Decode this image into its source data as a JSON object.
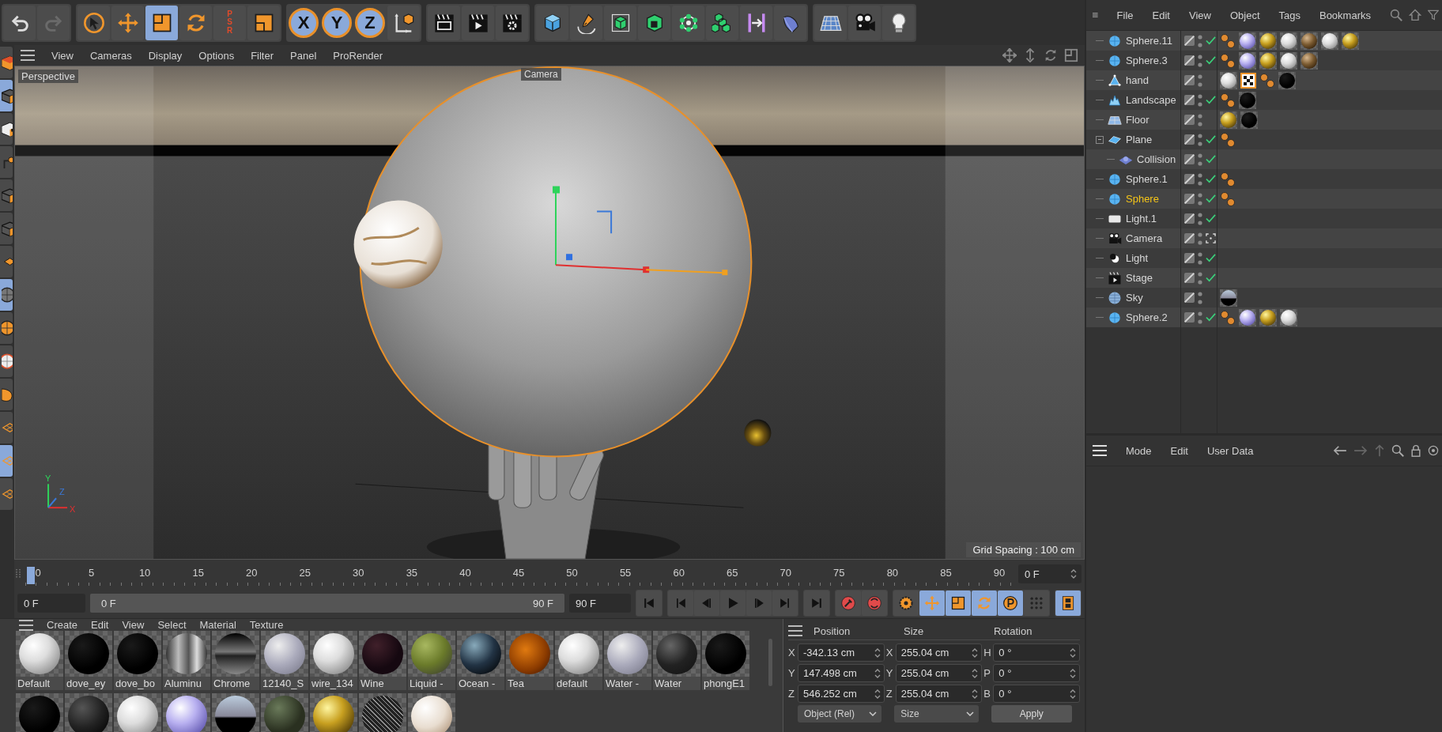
{
  "toolbar": [
    [
      {
        "kind": "undo",
        "selected": false
      },
      {
        "kind": "redo",
        "selected": false
      }
    ],
    [
      {
        "kind": "select",
        "selected": false
      },
      {
        "kind": "move",
        "selected": false
      },
      {
        "kind": "scale",
        "selected": true
      },
      {
        "kind": "rotate",
        "selected": false
      },
      {
        "kind": "psr",
        "label": "PSR",
        "selected": false
      },
      {
        "kind": "model",
        "selected": false
      }
    ],
    [
      {
        "kind": "axis",
        "label": "X",
        "selected": true
      },
      {
        "kind": "axis",
        "label": "Y",
        "selected": true
      },
      {
        "kind": "axis",
        "label": "Z",
        "selected": true
      },
      {
        "kind": "coord",
        "selected": false
      }
    ],
    [
      {
        "kind": "render-view",
        "selected": false
      },
      {
        "kind": "render",
        "selected": false
      },
      {
        "kind": "render-settings",
        "selected": false
      }
    ],
    [
      {
        "kind": "cube",
        "selected": false
      },
      {
        "kind": "pen",
        "selected": false
      },
      {
        "kind": "subdivide",
        "selected": false
      },
      {
        "kind": "extrude",
        "selected": false
      },
      {
        "kind": "cloner",
        "selected": false
      },
      {
        "kind": "array",
        "selected": false
      },
      {
        "kind": "symmetry",
        "selected": false
      },
      {
        "kind": "deformer",
        "selected": false
      }
    ],
    [
      {
        "kind": "floor",
        "selected": false
      },
      {
        "kind": "camera",
        "selected": false
      },
      {
        "kind": "light",
        "selected": false
      }
    ]
  ],
  "left_tools": [
    {
      "kind": "model",
      "selected": false
    },
    {
      "kind": "cube",
      "selected": true
    },
    {
      "kind": "checker",
      "selected": false
    },
    {
      "kind": "vertex",
      "selected": false
    },
    {
      "kind": "cube",
      "selected": false
    },
    {
      "kind": "cube",
      "selected": false
    },
    {
      "kind": "diamond",
      "selected": false
    },
    {
      "kind": "sphere",
      "selected": true
    },
    {
      "kind": "orange-sphere",
      "selected": false
    },
    {
      "kind": "white-sphere",
      "selected": false
    },
    {
      "kind": "blob",
      "selected": false
    },
    {
      "kind": "workplane",
      "selected": false
    },
    {
      "kind": "workplane",
      "selected": true
    },
    {
      "kind": "workplane",
      "selected": false
    }
  ],
  "viewport": {
    "menus": [
      "View",
      "Cameras",
      "Display",
      "Options",
      "Filter",
      "Panel",
      "ProRender"
    ],
    "name": "Perspective",
    "camera_label": "Camera",
    "grid_spacing": "Grid Spacing : 100 cm",
    "axes": [
      "Y",
      "Z",
      "X"
    ]
  },
  "timeline": {
    "ticks": [
      "0",
      "5",
      "10",
      "15",
      "20",
      "25",
      "30",
      "35",
      "40",
      "45",
      "50",
      "55",
      "60",
      "65",
      "70",
      "75",
      "80",
      "85",
      "90"
    ],
    "current_frame": "0 F",
    "start_field": "0 F",
    "range": {
      "start": "0 F",
      "end": "90 F",
      "level": 1
    },
    "end_field": "90 F",
    "controls": [
      [
        {
          "kind": "first",
          "selected": false
        }
      ],
      [
        {
          "kind": "prev-key",
          "selected": false
        },
        {
          "kind": "prev",
          "selected": false
        },
        {
          "kind": "play",
          "selected": false
        },
        {
          "kind": "next",
          "selected": false
        },
        {
          "kind": "next-key",
          "selected": false
        }
      ],
      [
        {
          "kind": "last",
          "selected": false
        }
      ],
      [
        {
          "kind": "record",
          "selected": false
        },
        {
          "kind": "autokey",
          "selected": false
        }
      ],
      [
        {
          "kind": "key-settings",
          "selected": false
        },
        {
          "kind": "move",
          "selected": true
        },
        {
          "kind": "scale",
          "selected": true
        },
        {
          "kind": "rotate",
          "selected": true
        },
        {
          "kind": "param",
          "selected": true
        },
        {
          "kind": "pla",
          "selected": false
        }
      ],
      [
        {
          "kind": "film",
          "selected": true
        }
      ]
    ]
  },
  "materials": {
    "menus": [
      "Create",
      "Edit",
      "View",
      "Select",
      "Material",
      "Texture"
    ],
    "items": [
      {
        "name": "Default",
        "kind": "white"
      },
      {
        "name": "dove_ey",
        "kind": "black"
      },
      {
        "name": "dove_bo",
        "kind": "black"
      },
      {
        "name": "Aluminu",
        "kind": "aluminium"
      },
      {
        "name": "Chrome",
        "kind": "chrome"
      },
      {
        "name": "12140_S",
        "kind": "glass"
      },
      {
        "name": "wire_134",
        "kind": "white"
      },
      {
        "name": "Wine",
        "kind": "wine"
      },
      {
        "name": "Liquid -",
        "kind": "olive"
      },
      {
        "name": "Ocean -",
        "kind": "ocean"
      },
      {
        "name": "Tea",
        "kind": "amber"
      },
      {
        "name": "default",
        "kind": "white"
      },
      {
        "name": "Water -",
        "kind": "glass"
      },
      {
        "name": "Water",
        "kind": "dark-glass"
      },
      {
        "name": "phongE1",
        "kind": "black"
      }
    ],
    "second_row": [
      {
        "kind": "black"
      },
      {
        "kind": "dark"
      },
      {
        "kind": "white"
      },
      {
        "kind": "violet"
      },
      {
        "kind": "sky"
      },
      {
        "kind": "dark-green"
      },
      {
        "kind": "gold"
      },
      {
        "kind": "wire"
      },
      {
        "kind": "marble"
      }
    ]
  },
  "coordinates": {
    "columns": [
      {
        "title": "Position",
        "fields": [
          {
            "axis": "X",
            "value": "-342.13 cm"
          },
          {
            "axis": "Y",
            "value": "147.498 cm"
          },
          {
            "axis": "Z",
            "value": "546.252 cm"
          }
        ]
      },
      {
        "title": "Size",
        "fields": [
          {
            "axis": "X",
            "value": "255.04 cm"
          },
          {
            "axis": "Y",
            "value": "255.04 cm"
          },
          {
            "axis": "Z",
            "value": "255.04 cm"
          }
        ]
      },
      {
        "title": "Rotation",
        "fields": [
          {
            "axis": "H",
            "value": "0 °"
          },
          {
            "axis": "P",
            "value": "0 °"
          },
          {
            "axis": "B",
            "value": "0 °"
          }
        ]
      }
    ],
    "dropdowns": [
      "Object (Rel)",
      "Size"
    ],
    "apply": "Apply"
  },
  "object_manager": {
    "menus": [
      "File",
      "Edit",
      "View",
      "Object",
      "Tags",
      "Bookmarks"
    ],
    "objects": [
      {
        "name": "Sphere.11",
        "kind": "sphere",
        "selected": false,
        "checked": true,
        "tags": [
          {
            "kind": "phong"
          },
          {
            "kind": "violet"
          },
          {
            "kind": "gold"
          },
          {
            "kind": "white"
          },
          {
            "kind": "bronze"
          },
          {
            "kind": "white"
          },
          {
            "kind": "gold"
          }
        ]
      },
      {
        "name": "Sphere.3",
        "kind": "sphere",
        "selected": false,
        "checked": true,
        "tags": [
          {
            "kind": "phong"
          },
          {
            "kind": "violet"
          },
          {
            "kind": "gold"
          },
          {
            "kind": "white"
          },
          {
            "kind": "bronze"
          }
        ]
      },
      {
        "name": "hand",
        "kind": "polygon",
        "selected": false,
        "checked": false,
        "tags": [
          {
            "kind": "white"
          },
          {
            "kind": "checker"
          },
          {
            "kind": "phong"
          },
          {
            "kind": "black"
          }
        ]
      },
      {
        "name": "Landscape",
        "kind": "landscape",
        "selected": false,
        "checked": true,
        "tags": [
          {
            "kind": "phong"
          },
          {
            "kind": "black"
          }
        ]
      },
      {
        "name": "Floor",
        "kind": "floor",
        "selected": false,
        "checked": false,
        "tags": [
          {
            "kind": "gold"
          },
          {
            "kind": "black"
          }
        ]
      },
      {
        "name": "Plane",
        "kind": "plane",
        "selected": false,
        "checked": true,
        "tags": [
          {
            "kind": "phong"
          }
        ],
        "expanded": true,
        "children": [
          {
            "name": "Collision",
            "kind": "collision",
            "selected": false,
            "checked": true
          }
        ]
      },
      {
        "name": "Sphere.1",
        "kind": "sphere",
        "selected": false,
        "checked": true,
        "tags": [
          {
            "kind": "phong"
          }
        ]
      },
      {
        "name": "Sphere",
        "kind": "sphere",
        "selected": true,
        "checked": true,
        "tags": [
          {
            "kind": "phong"
          }
        ]
      },
      {
        "name": "Light.1",
        "kind": "area-light",
        "selected": false,
        "checked": true
      },
      {
        "name": "Camera",
        "kind": "camera",
        "selected": false,
        "checked": true
      },
      {
        "name": "Light",
        "kind": "spot-light",
        "selected": false,
        "checked": true
      },
      {
        "name": "Stage",
        "kind": "stage",
        "selected": false,
        "checked": true
      },
      {
        "name": "Sky",
        "kind": "sky",
        "selected": false,
        "checked": false,
        "tags": [
          {
            "kind": "sky"
          }
        ]
      },
      {
        "name": "Sphere.2",
        "kind": "sphere",
        "selected": false,
        "checked": true,
        "tags": [
          {
            "kind": "phong"
          },
          {
            "kind": "violet"
          },
          {
            "kind": "gold"
          },
          {
            "kind": "white"
          }
        ]
      }
    ]
  },
  "attribute_manager": {
    "menus": [
      "Mode",
      "Edit",
      "User Data"
    ]
  }
}
